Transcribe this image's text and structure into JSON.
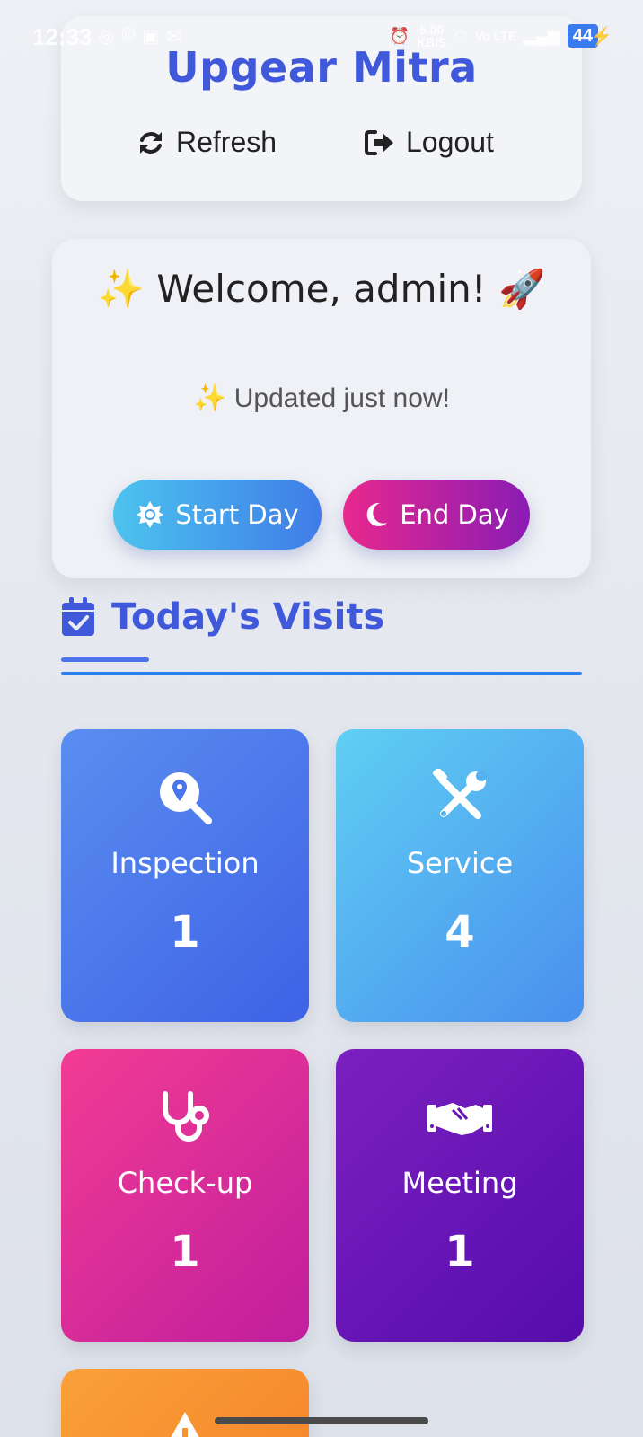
{
  "status_bar": {
    "time": "12:33",
    "speed_value": "5.00",
    "speed_unit": "KB/S",
    "network": "Vo LTE",
    "battery": "44"
  },
  "header": {
    "title": "Upgear Mitra",
    "refresh_label": "Refresh",
    "logout_label": "Logout"
  },
  "welcome": {
    "title": "✨ Welcome, admin! 🚀",
    "subtitle": "✨ Updated just now!",
    "start_day_label": "Start Day",
    "end_day_label": "End Day"
  },
  "visits": {
    "section_title": "Today's Visits",
    "cards": [
      {
        "label": "Inspection",
        "count": "1",
        "icon": "search-location-icon"
      },
      {
        "label": "Service",
        "count": "4",
        "icon": "tools-icon"
      },
      {
        "label": "Check-up",
        "count": "1",
        "icon": "stethoscope-icon"
      },
      {
        "label": "Meeting",
        "count": "1",
        "icon": "handshake-icon"
      },
      {
        "label": "",
        "count": "",
        "icon": "warning-icon"
      }
    ]
  },
  "colors": {
    "brand": "#4059db",
    "inspection": "#4a75ea",
    "service": "#52acef",
    "checkup": "#d92a98",
    "meeting": "#6a16b6",
    "other": "#f7922f"
  }
}
